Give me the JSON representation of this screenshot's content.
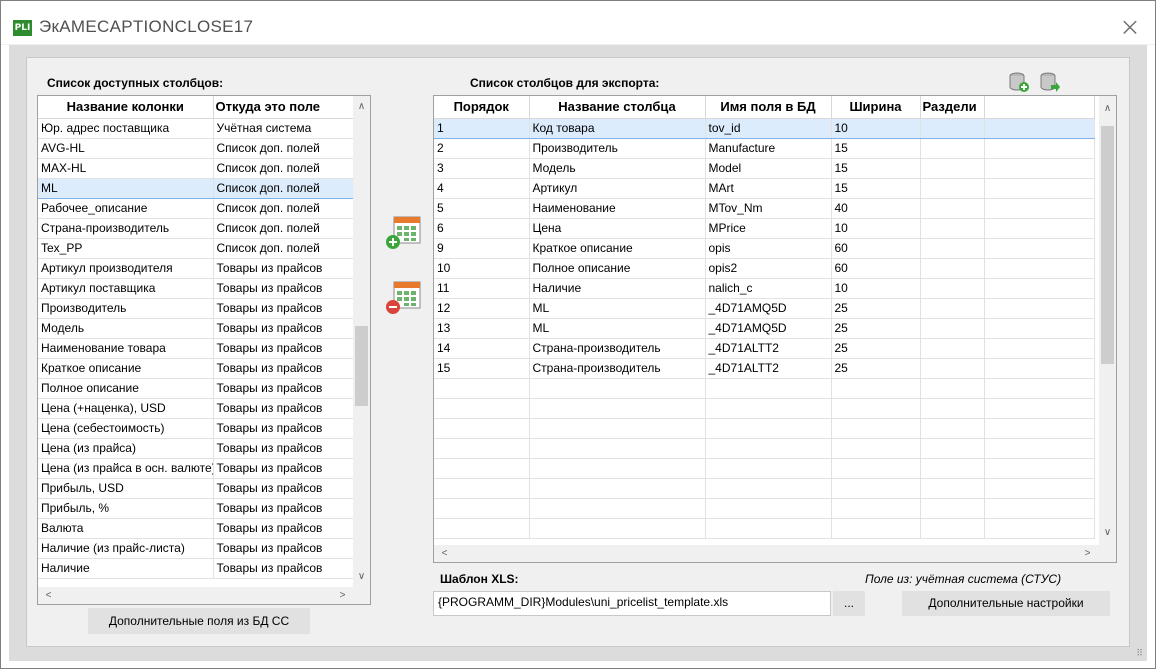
{
  "window": {
    "title": "ЭкAMECAPTIONCLOSE17",
    "icon_text": "PLI",
    "close_glyph": "⨉"
  },
  "left_panel": {
    "label": "Список доступных столбцов:",
    "columns": [
      "Название колонки",
      "Откуда это поле"
    ],
    "rows": [
      [
        "Юр. адрес поставщика",
        "Учётная система"
      ],
      [
        "AVG-HL",
        "Список доп. полей"
      ],
      [
        "MAX-HL",
        "Список доп. полей"
      ],
      [
        "ML",
        "Список доп. полей"
      ],
      [
        "Рабочее_описание",
        "Список доп. полей"
      ],
      [
        "Страна-производитель",
        "Список доп. полей"
      ],
      [
        "Tex_PP",
        "Список доп. полей"
      ],
      [
        "Артикул производителя",
        "Товары из прайсов"
      ],
      [
        "Артикул поставщика",
        "Товары из прайсов"
      ],
      [
        "Производитель",
        "Товары из прайсов"
      ],
      [
        "Модель",
        "Товары из прайсов"
      ],
      [
        "Наименование товара",
        "Товары из прайсов"
      ],
      [
        "Краткое описание",
        "Товары из прайсов"
      ],
      [
        "Полное описание",
        "Товары из прайсов"
      ],
      [
        "Цена (+наценка), USD",
        "Товары из прайсов"
      ],
      [
        "Цена (себестоимость)",
        "Товары из прайсов"
      ],
      [
        "Цена (из прайса)",
        "Товары из прайсов"
      ],
      [
        "Цена (из прайса в осн. валюте)",
        "Товары из прайсов"
      ],
      [
        "Прибыль, USD",
        "Товары из прайсов"
      ],
      [
        "Прибыль, %",
        "Товары из прайсов"
      ],
      [
        "Валюта",
        "Товары из прайсов"
      ],
      [
        "Наличие (из прайс-листа)",
        "Товары из прайсов"
      ],
      [
        "Наличие",
        "Товары из прайсов"
      ]
    ],
    "selected_index": 3,
    "extra_fields_button": "Дополнительные поля из БД СС"
  },
  "right_panel": {
    "label": "Список столбцов для экспорта:",
    "columns": [
      "Порядок",
      "Название столбца",
      "Имя поля в БД",
      "Ширина",
      "Раздели"
    ],
    "rows": [
      [
        "1",
        "Код товара",
        "tov_id",
        "10",
        ""
      ],
      [
        "2",
        "Производитель",
        "Manufacture",
        "15",
        ""
      ],
      [
        "3",
        "Модель",
        "Model",
        "15",
        ""
      ],
      [
        "4",
        "Артикул",
        "MArt",
        "15",
        ""
      ],
      [
        "5",
        "Наименование",
        "MTov_Nm",
        "40",
        ""
      ],
      [
        "6",
        "Цена",
        "MPrice",
        "10",
        ""
      ],
      [
        "9",
        "Краткое описание",
        "opis",
        "60",
        ""
      ],
      [
        "10",
        "Полное описание",
        "opis2",
        "60",
        ""
      ],
      [
        "11",
        "Наличие",
        "nalich_c",
        "10",
        ""
      ],
      [
        "12",
        "ML",
        "_4D71AMQ5D",
        "25",
        ""
      ],
      [
        "13",
        "ML",
        "_4D71AMQ5D",
        "25",
        ""
      ],
      [
        "14",
        "Страна-производитель",
        "_4D71ALTT2",
        "25",
        ""
      ],
      [
        "15",
        "Страна-производитель",
        "_4D71ALTT2",
        "25",
        ""
      ]
    ],
    "empty_rows": 8,
    "selected_index": 0
  },
  "template": {
    "label": "Шаблон XLS:",
    "path": "{PROGRAMM_DIR}Modules\\uni_pricelist_template.xls",
    "browse_label": "...",
    "fields_from": "Поле из:  учётная система (СТУС)",
    "advanced_button": "Дополнительные настройки"
  },
  "icons": {
    "add_column": "calendar-add-icon",
    "remove_column": "calendar-remove-icon",
    "db_add": "database-add-icon",
    "db_export": "database-export-icon"
  },
  "colors": {
    "selection": "#dcecfc",
    "selection_border": "#7eb4ea",
    "panel": "#f0f0f0",
    "client": "#dcdcdc",
    "app_icon": "#2e8b2e",
    "add_green": "#3aa63a",
    "remove_red": "#d9453a"
  }
}
